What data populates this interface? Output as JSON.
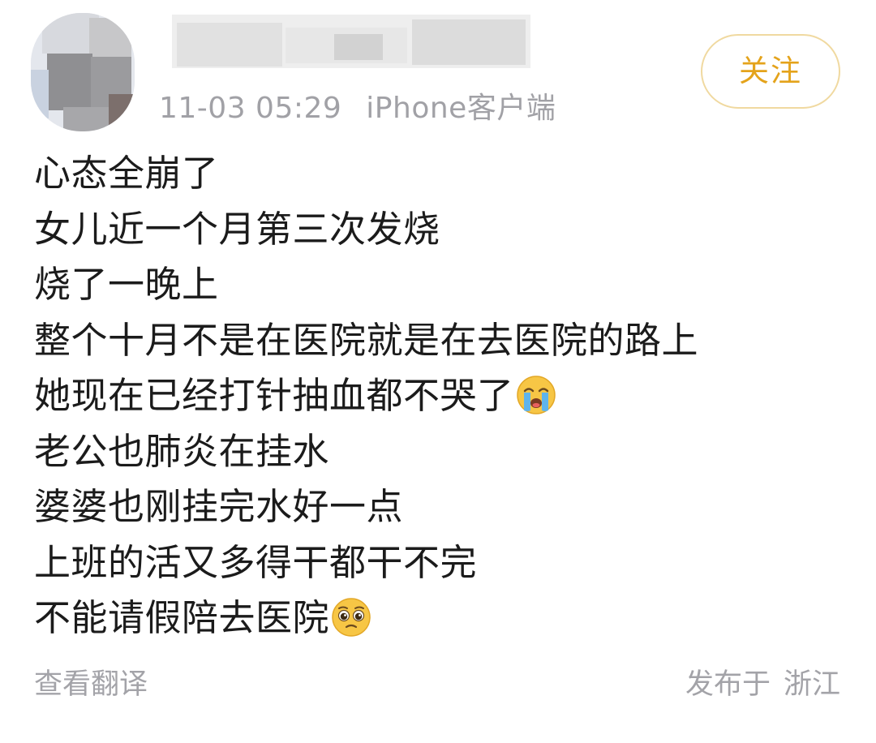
{
  "header": {
    "timestamp": "11-03 05:29",
    "client": "iPhone客户端",
    "follow_label": "关注"
  },
  "post": {
    "lines": [
      {
        "text": "心态全崩了",
        "emoji": ""
      },
      {
        "text": "女儿近一个月第三次发烧",
        "emoji": ""
      },
      {
        "text": "烧了一晚上",
        "emoji": ""
      },
      {
        "text": "整个十月不是在医院就是在去医院的路上",
        "emoji": ""
      },
      {
        "text": "她现在已经打针抽血都不哭了",
        "emoji": "loudly-crying-face-icon"
      },
      {
        "text": "老公也肺炎在挂水",
        "emoji": ""
      },
      {
        "text": "婆婆也刚挂完水好一点",
        "emoji": ""
      },
      {
        "text": "上班的活又多得干都干不完",
        "emoji": ""
      },
      {
        "text": "不能请假陪去医院",
        "emoji": "pleading-face-icon"
      }
    ]
  },
  "footer": {
    "translate_label": "查看翻译",
    "published_prefix": "发布于",
    "location": "浙江"
  },
  "colors": {
    "follow_accent": "#e4a31b",
    "follow_border": "#f0d9a0",
    "meta_gray": "#a1a1a6",
    "body_text": "#1b1b1b"
  }
}
